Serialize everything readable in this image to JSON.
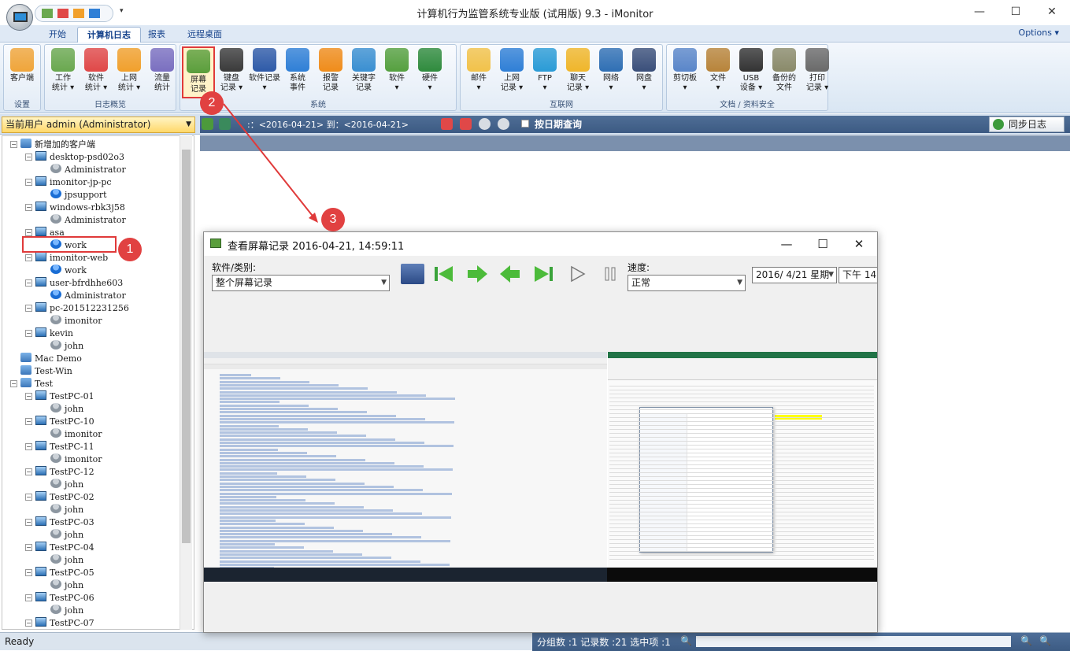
{
  "window": {
    "title": "计算机行为监管系统专业版 (试用版) 9.3 - iMonitor",
    "min": "—",
    "max": "☐",
    "close": "✕"
  },
  "tabs": [
    "开始",
    "计算机日志",
    "报表",
    "远程桌面"
  ],
  "options_label": "Options ▾",
  "ribbon": {
    "groups": [
      {
        "label": "设置",
        "buttons": [
          {
            "label": "客户端",
            "icon": "client-icon",
            "color": "#f0a53a"
          }
        ]
      },
      {
        "label": "日志概览",
        "buttons": [
          {
            "label": "工作\n统计 ▾",
            "icon": "work-stats-icon",
            "color": "#6aa84f"
          },
          {
            "label": "软件\n统计 ▾",
            "icon": "software-stats-icon",
            "color": "#e04848"
          },
          {
            "label": "上网\n统计 ▾",
            "icon": "web-stats-icon",
            "color": "#f1a02c"
          },
          {
            "label": "流量\n统计",
            "icon": "traffic-stats-icon",
            "color": "#7a6fc0"
          }
        ]
      },
      {
        "label": "系统",
        "buttons": [
          {
            "label": "屏幕\n记录",
            "icon": "screen-record-icon",
            "color": "#5a9e3c"
          },
          {
            "label": "键盘\n记录 ▾",
            "icon": "keyboard-record-icon",
            "color": "#3a3a3a"
          },
          {
            "label": "软件记录\n▾",
            "icon": "software-record-icon",
            "color": "#2e5aa8"
          },
          {
            "label": "系统\n事件",
            "icon": "system-event-icon",
            "color": "#2f7fd6"
          },
          {
            "label": "报警\n记录",
            "icon": "alarm-record-icon",
            "color": "#f08c1a"
          },
          {
            "label": "关键字\n记录",
            "icon": "keyword-record-icon",
            "color": "#3a8fd1"
          },
          {
            "label": "软件\n▾",
            "icon": "software-icon",
            "color": "#55a03f"
          },
          {
            "label": "硬件\n▾",
            "icon": "hardware-icon",
            "color": "#2f8b3d"
          }
        ]
      },
      {
        "label": "互联网",
        "buttons": [
          {
            "label": "邮件\n▾",
            "icon": "mail-icon",
            "color": "#f2c24a"
          },
          {
            "label": "上网\n记录 ▾",
            "icon": "web-record-icon",
            "color": "#2f7fd6"
          },
          {
            "label": "FTP\n▾",
            "icon": "ftp-icon",
            "color": "#2a9bd6"
          },
          {
            "label": "聊天\n记录 ▾",
            "icon": "chat-record-icon",
            "color": "#f0b62a"
          },
          {
            "label": "网络\n▾",
            "icon": "network-icon",
            "color": "#2f6fb4"
          },
          {
            "label": "网盘\n▾",
            "icon": "net-disk-icon",
            "color": "#3a4f7a"
          }
        ]
      },
      {
        "label": "文档 / 资料安全",
        "buttons": [
          {
            "label": "剪切板\n▾",
            "icon": "clipboard-icon",
            "color": "#5a86c9"
          },
          {
            "label": "文件\n▾",
            "icon": "file-icon",
            "color": "#b8843a"
          },
          {
            "label": "USB\n设备 ▾",
            "icon": "usb-icon",
            "color": "#333333"
          },
          {
            "label": "备份的\n文件",
            "icon": "backup-file-icon",
            "color": "#8a8a6a"
          },
          {
            "label": "打印\n记录 ▾",
            "icon": "print-record-icon",
            "color": "#6a6a6a"
          }
        ]
      }
    ]
  },
  "user_combo": "当前用户 admin (Administrator)",
  "date_range": ":：<2016-04-21> 到：<2016-04-21>",
  "date_query_label": "按日期查询",
  "sync_label": "同步日志",
  "tree": [
    {
      "label": "新增加的客户端",
      "level": 0,
      "type": "group",
      "exp": "−"
    },
    {
      "label": "desktop-psd02o3",
      "level": 1,
      "type": "pc",
      "exp": "−"
    },
    {
      "label": "Administrator",
      "level": 2,
      "type": "user-off"
    },
    {
      "label": "imonitor-jp-pc",
      "level": 1,
      "type": "pc",
      "exp": "−"
    },
    {
      "label": "jpsupport",
      "level": 2,
      "type": "user-on"
    },
    {
      "label": "windows-rbk3j58",
      "level": 1,
      "type": "pc",
      "exp": "−"
    },
    {
      "label": "Administrator",
      "level": 2,
      "type": "user-off"
    },
    {
      "label": "asa",
      "level": 1,
      "type": "pc",
      "exp": "−"
    },
    {
      "label": "work",
      "level": 2,
      "type": "user-on"
    },
    {
      "label": "imonitor-web",
      "level": 1,
      "type": "pc",
      "exp": "−"
    },
    {
      "label": "work",
      "level": 2,
      "type": "user-on"
    },
    {
      "label": "user-bfrdhhe603",
      "level": 1,
      "type": "pc",
      "exp": "−"
    },
    {
      "label": "Administrator",
      "level": 2,
      "type": "user-on"
    },
    {
      "label": "pc-201512231256",
      "level": 1,
      "type": "pc",
      "exp": "−"
    },
    {
      "label": "imonitor",
      "level": 2,
      "type": "user-off"
    },
    {
      "label": "kevin",
      "level": 1,
      "type": "pc",
      "exp": "−"
    },
    {
      "label": "john",
      "level": 2,
      "type": "user-off"
    },
    {
      "label": "Mac Demo",
      "level": 0,
      "type": "group",
      "exp": ""
    },
    {
      "label": "Test-Win",
      "level": 0,
      "type": "group",
      "exp": ""
    },
    {
      "label": "Test",
      "level": 0,
      "type": "group",
      "exp": "−"
    },
    {
      "label": "TestPC-01",
      "level": 1,
      "type": "pc",
      "exp": "−"
    },
    {
      "label": "john",
      "level": 2,
      "type": "user-off"
    },
    {
      "label": "TestPC-10",
      "level": 1,
      "type": "pc",
      "exp": "−"
    },
    {
      "label": "imonitor",
      "level": 2,
      "type": "user-off"
    },
    {
      "label": "TestPC-11",
      "level": 1,
      "type": "pc",
      "exp": "−"
    },
    {
      "label": "imonitor",
      "level": 2,
      "type": "user-off"
    },
    {
      "label": "TestPC-12",
      "level": 1,
      "type": "pc",
      "exp": "−"
    },
    {
      "label": "john",
      "level": 2,
      "type": "user-off"
    },
    {
      "label": "TestPC-02",
      "level": 1,
      "type": "pc",
      "exp": "−"
    },
    {
      "label": "john",
      "level": 2,
      "type": "user-off"
    },
    {
      "label": "TestPC-03",
      "level": 1,
      "type": "pc",
      "exp": "−"
    },
    {
      "label": "john",
      "level": 2,
      "type": "user-off"
    },
    {
      "label": "TestPC-04",
      "level": 1,
      "type": "pc",
      "exp": "−"
    },
    {
      "label": "john",
      "level": 2,
      "type": "user-off"
    },
    {
      "label": "TestPC-05",
      "level": 1,
      "type": "pc",
      "exp": "−"
    },
    {
      "label": "john",
      "level": 2,
      "type": "user-off"
    },
    {
      "label": "TestPC-06",
      "level": 1,
      "type": "pc",
      "exp": "−"
    },
    {
      "label": "john",
      "level": 2,
      "type": "user-off"
    },
    {
      "label": "TestPC-07",
      "level": 1,
      "type": "pc",
      "exp": "−"
    }
  ],
  "badges": [
    "1",
    "2",
    "3"
  ],
  "dialog": {
    "title": "查看屏幕记录 2016-04-21, 14:59:11",
    "software_label": "软件/类别:",
    "software_value": "整个屏幕记录",
    "speed_label": "速度:",
    "speed_value": "正常",
    "date_value": "2016/ 4/21 星期",
    "time_value": "下午 14:"
  },
  "status": {
    "ready": "Ready",
    "summary": "分组数 :1  记录数 :21  选中项 :1"
  }
}
